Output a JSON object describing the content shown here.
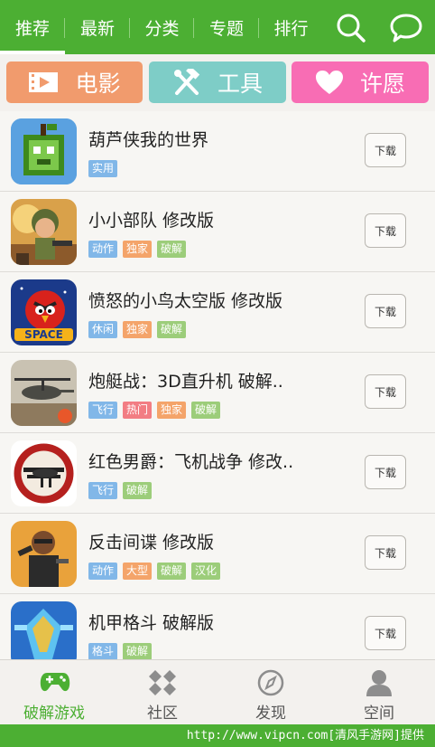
{
  "top_nav": {
    "tabs": [
      {
        "label": "推荐"
      },
      {
        "label": "最新"
      },
      {
        "label": "分类"
      },
      {
        "label": "专题"
      },
      {
        "label": "排行"
      }
    ]
  },
  "quick_links": [
    {
      "label": "电影",
      "color": "#f19b6d"
    },
    {
      "label": "工具",
      "color": "#7ecdc7"
    },
    {
      "label": "许愿",
      "color": "#f86db4"
    }
  ],
  "tag_colors": {
    "blue": "#81b7e8",
    "orange": "#f4a46a",
    "green": "#9ccd7a",
    "red": "#f27d83"
  },
  "apps": [
    {
      "title": "葫芦侠我的世界",
      "tags": [
        "实用"
      ],
      "download": "下载"
    },
    {
      "title": "小小部队  修改版",
      "tags": [
        "动作",
        "独家",
        "破解"
      ],
      "download": "下载"
    },
    {
      "title": "愤怒的小鸟太空版  修改版",
      "tags": [
        "休闲",
        "独家",
        "破解"
      ],
      "download": "下载"
    },
    {
      "title": "炮艇战：3D直升机  破解..",
      "tags": [
        "飞行",
        "热门",
        "独家",
        "破解"
      ],
      "download": "下载"
    },
    {
      "title": "红色男爵：飞机战争  修改..",
      "tags": [
        "飞行",
        "破解"
      ],
      "download": "下载"
    },
    {
      "title": "反击间谍    修改版",
      "tags": [
        "动作",
        "大型",
        "破解",
        "汉化"
      ],
      "download": "下载"
    },
    {
      "title": "机甲格斗  破解版",
      "tags": [
        "格斗",
        "破解"
      ],
      "download": "下载"
    }
  ],
  "bottom_nav": [
    {
      "label": "破解游戏"
    },
    {
      "label": "社区"
    },
    {
      "label": "发现"
    },
    {
      "label": "空间"
    }
  ],
  "footer": {
    "text": "http://www.vipcn.com[清风手游网]提供"
  }
}
